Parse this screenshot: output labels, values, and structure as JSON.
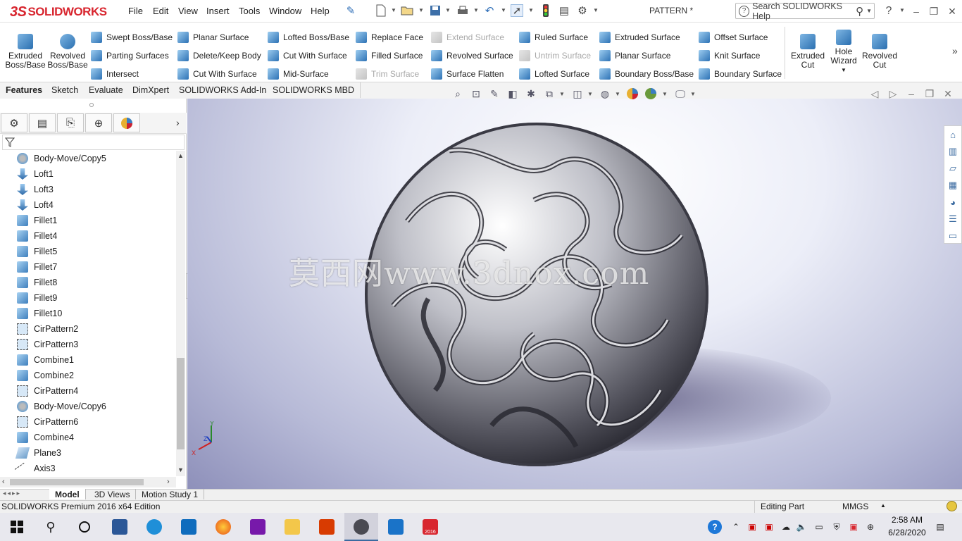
{
  "app": {
    "logo": "SOLIDWORKS",
    "logo_mark": "3S",
    "document_title": "PATTERN *"
  },
  "menu": [
    "File",
    "Edit",
    "View",
    "Insert",
    "Tools",
    "Window",
    "Help"
  ],
  "search": {
    "placeholder": "Search SOLIDWORKS Help"
  },
  "help_icon": "?",
  "ribbon": {
    "big_left": [
      {
        "label": "Extruded Boss/Base",
        "icon": "extruded-boss-icon"
      },
      {
        "label": "Revolved Boss/Base",
        "icon": "revolved-boss-icon"
      }
    ],
    "columns": [
      [
        {
          "label": "Swept Boss/Base",
          "enabled": true
        },
        {
          "label": "Parting Surfaces",
          "enabled": true
        },
        {
          "label": "Intersect",
          "enabled": true
        }
      ],
      [
        {
          "label": "Planar Surface",
          "enabled": true
        },
        {
          "label": "Delete/Keep Body",
          "enabled": true
        },
        {
          "label": "Cut With Surface",
          "enabled": true
        }
      ],
      [
        {
          "label": "Lofted Boss/Base",
          "enabled": true
        },
        {
          "label": "Cut With Surface",
          "enabled": true
        },
        {
          "label": "Mid-Surface",
          "enabled": true
        }
      ],
      [
        {
          "label": "Replace Face",
          "enabled": true
        },
        {
          "label": "Filled Surface",
          "enabled": true
        },
        {
          "label": "Trim Surface",
          "enabled": false
        }
      ],
      [
        {
          "label": "Extend Surface",
          "enabled": false
        },
        {
          "label": "Revolved Surface",
          "enabled": true
        },
        {
          "label": "Surface Flatten",
          "enabled": true
        }
      ],
      [
        {
          "label": "Ruled Surface",
          "enabled": true
        },
        {
          "label": "Untrim Surface",
          "enabled": false
        },
        {
          "label": "Lofted Surface",
          "enabled": true
        }
      ],
      [
        {
          "label": "Extruded Surface",
          "enabled": true
        },
        {
          "label": "Planar Surface",
          "enabled": true
        },
        {
          "label": "Boundary Boss/Base",
          "enabled": true
        }
      ],
      [
        {
          "label": "Offset Surface",
          "enabled": true
        },
        {
          "label": "Knit Surface",
          "enabled": true
        },
        {
          "label": "Boundary Surface",
          "enabled": true
        }
      ]
    ],
    "big_right": [
      {
        "label": "Extruded Cut",
        "icon": "extruded-cut-icon"
      },
      {
        "label": "Hole Wizard",
        "icon": "hole-wizard-icon"
      },
      {
        "label": "Revolved Cut",
        "icon": "revolved-cut-icon"
      }
    ],
    "more": "»"
  },
  "tabs": [
    {
      "label": "Features",
      "active": true
    },
    {
      "label": "Sketch",
      "active": false
    },
    {
      "label": "Evaluate",
      "active": false
    },
    {
      "label": "DimXpert",
      "active": false
    },
    {
      "label": "SOLIDWORKS Add-Ins",
      "active": false
    },
    {
      "label": "SOLIDWORKS MBD",
      "active": false
    }
  ],
  "feature_tree": [
    {
      "label": "Body-Move/Copy5",
      "icon": "move-icon"
    },
    {
      "label": "Loft1",
      "icon": "loft-icon"
    },
    {
      "label": "Loft3",
      "icon": "loft-icon"
    },
    {
      "label": "Loft4",
      "icon": "loft-icon"
    },
    {
      "label": "Fillet1",
      "icon": "fillet-icon"
    },
    {
      "label": "Fillet4",
      "icon": "fillet-icon"
    },
    {
      "label": "Fillet5",
      "icon": "fillet-icon"
    },
    {
      "label": "Fillet7",
      "icon": "fillet-icon"
    },
    {
      "label": "Fillet8",
      "icon": "fillet-icon"
    },
    {
      "label": "Fillet9",
      "icon": "fillet-icon"
    },
    {
      "label": "Fillet10",
      "icon": "fillet-icon"
    },
    {
      "label": "CirPattern2",
      "icon": "pattern-icon"
    },
    {
      "label": "CirPattern3",
      "icon": "pattern-icon"
    },
    {
      "label": "Combine1",
      "icon": "combine-icon"
    },
    {
      "label": "Combine2",
      "icon": "combine-icon"
    },
    {
      "label": "CirPattern4",
      "icon": "pattern-icon"
    },
    {
      "label": "Body-Move/Copy6",
      "icon": "move-icon"
    },
    {
      "label": "CirPattern6",
      "icon": "pattern-icon"
    },
    {
      "label": "Combine4",
      "icon": "combine-icon"
    },
    {
      "label": "Plane3",
      "icon": "plane-icon"
    },
    {
      "label": "Axis3",
      "icon": "axis-icon"
    }
  ],
  "viewport": {
    "watermark": "莫西网www.3dnox.com"
  },
  "triad": {
    "x": "X",
    "y": "Y",
    "z": "Z"
  },
  "bottom_tabs": [
    {
      "label": "Model",
      "active": true
    },
    {
      "label": "3D Views",
      "active": false
    },
    {
      "label": "Motion Study 1",
      "active": false
    }
  ],
  "status": {
    "edition": "SOLIDWORKS Premium 2016 x64 Edition",
    "mode": "Editing Part",
    "units": "MMGS"
  },
  "taskbar": {
    "time": "2:58 AM",
    "date": "6/28/2020",
    "sw_badge": "2016"
  },
  "colors": {
    "brand": "#d8262f",
    "accent": "#2a6fb0",
    "viewport_bg": "#b7bad7"
  }
}
